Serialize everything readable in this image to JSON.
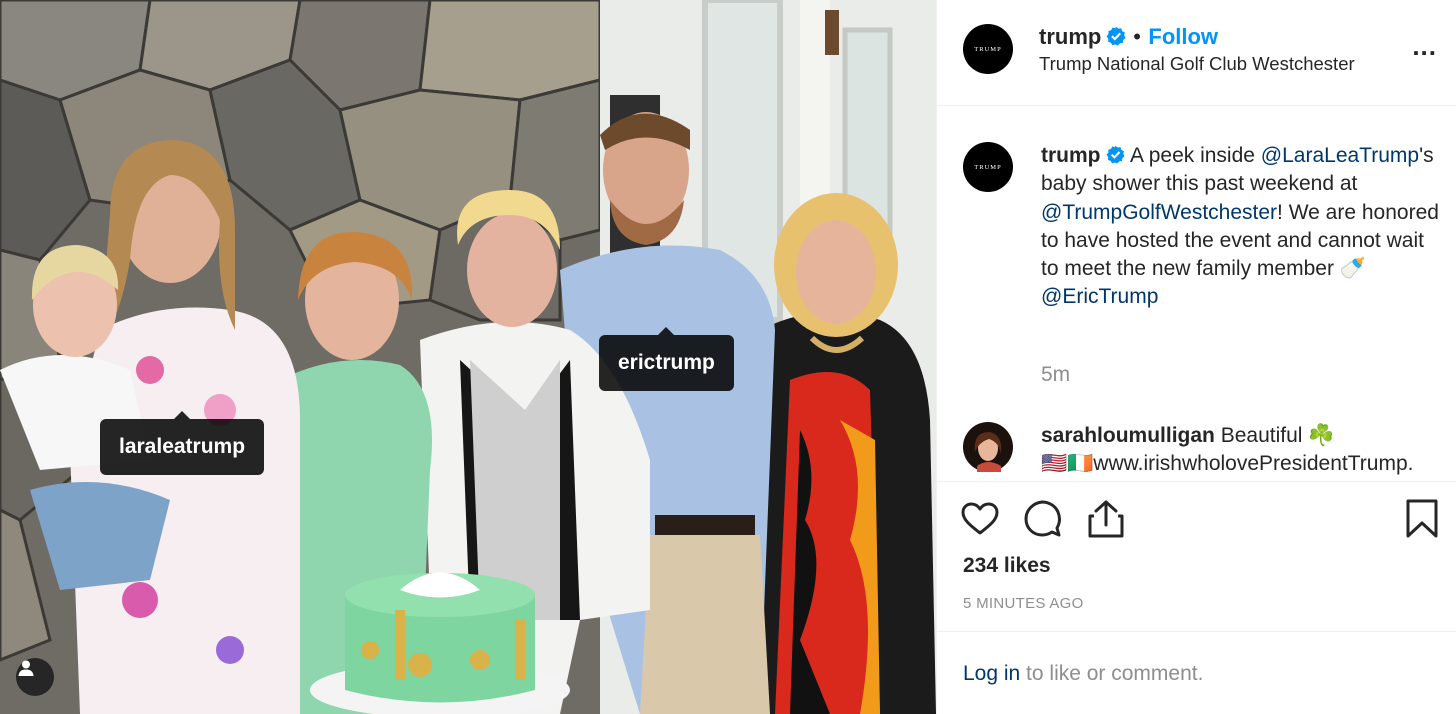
{
  "photo": {
    "tags": [
      {
        "label": "laraleatrump"
      },
      {
        "label": "erictrump"
      }
    ]
  },
  "header": {
    "username": "trump",
    "separator": "•",
    "follow_label": "Follow",
    "location": "Trump National Golf Club Westchester",
    "avatar_text": "TRUMP",
    "more_label": "..."
  },
  "caption": {
    "username": "trump",
    "text_1": "A peek inside ",
    "mention_1": "@LaraLeaTrump",
    "text_2": "'s baby shower this past weekend at ",
    "mention_2": "@TrumpGolfWestchester",
    "text_3": "! We are honored to have hosted the event and cannot wait to meet the new family member ",
    "emoji": "🍼",
    "mention_3": "@EricTrump",
    "time": "5m"
  },
  "comment": {
    "username": "sarahloumulligan",
    "text": "Beautiful ☘️",
    "flags": "🇺🇸🇮🇪",
    "text_2": "www.irishwholovePresidentTrump."
  },
  "stats": {
    "likes": "234 likes",
    "time_ago": "5 MINUTES AGO"
  },
  "login": {
    "link_text": "Log in",
    "rest_text": " to like or comment."
  },
  "colors": {
    "accent": "#0095f6",
    "link": "#00376b",
    "muted": "#8e8e8e"
  }
}
